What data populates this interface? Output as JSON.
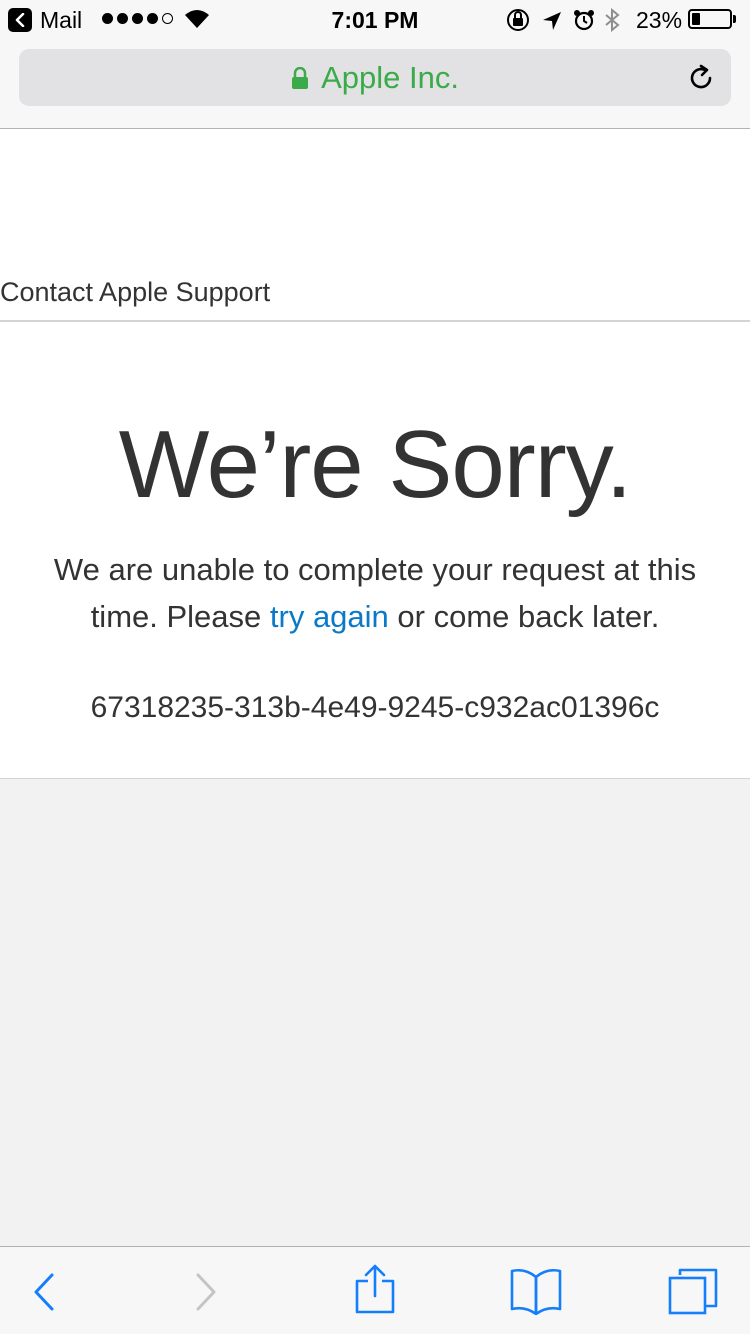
{
  "status_bar": {
    "back_app": "Mail",
    "time": "7:01 PM",
    "battery_text": "23%",
    "battery_level_fraction": 0.23,
    "signal_bars_filled": 4,
    "signal_bars_total": 5,
    "icons": [
      "back-chevron-icon",
      "wifi-icon",
      "orientation-lock-icon",
      "location-arrow-icon",
      "alarm-icon",
      "bluetooth-icon",
      "battery-icon"
    ]
  },
  "address_bar": {
    "title": "Apple Inc.",
    "title_color": "#3aab48",
    "icons": [
      "lock-icon",
      "reload-icon"
    ]
  },
  "page": {
    "contact_link": "Contact Apple Support",
    "heading": "We’re Sorry.",
    "message_before_link": "We are unable to complete your request at this time. Please ",
    "message_link": "try again",
    "message_after_link": " or come back later.",
    "link_color": "#0a7ac8",
    "error_id": "67318235-313b-4e49-9245-c932ac01396c"
  },
  "toolbar": {
    "accent": "#157efb",
    "buttons": [
      {
        "name": "back-button",
        "icon": "chevron-left-icon",
        "enabled": true
      },
      {
        "name": "forward-button",
        "icon": "chevron-right-icon",
        "enabled": false
      },
      {
        "name": "share-button",
        "icon": "share-icon",
        "enabled": true
      },
      {
        "name": "bookmarks-button",
        "icon": "book-icon",
        "enabled": true
      },
      {
        "name": "tabs-button",
        "icon": "tabs-icon",
        "enabled": true
      }
    ]
  }
}
